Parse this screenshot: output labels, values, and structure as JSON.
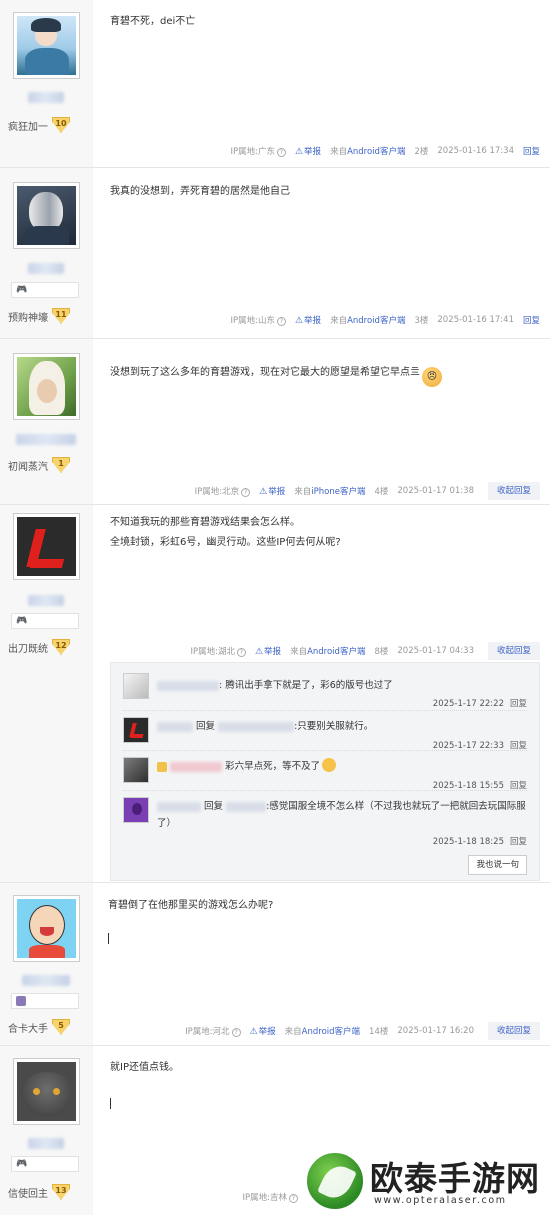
{
  "posts": [
    {
      "text": [
        "育碧不死，dei不亡"
      ],
      "level_name": "疯狂加一",
      "level_num": "10",
      "ip": "IP属地:广东",
      "report": "举报",
      "client_prefix": "来自",
      "client": "Android客户端",
      "floor": "2楼",
      "time": "2025-01-16 17:34",
      "reply": "回复"
    },
    {
      "text": [
        "我真的没想到，弄死育碧的居然是他自己"
      ],
      "level_name": "预购神壕",
      "level_num": "11",
      "ip": "IP属地:山东",
      "report": "举报",
      "client_prefix": "来自",
      "client": "Android客户端",
      "floor": "3楼",
      "time": "2025-01-16 17:41",
      "reply": "回复"
    },
    {
      "text": [
        "没想到玩了这么多年的育碧游戏，现在对它最大的愿望是希望它早点亖"
      ],
      "level_name": "初闻蒸汽",
      "level_num": "1",
      "ip": "IP属地:北京",
      "report": "举报",
      "client_prefix": "来自",
      "client": "iPhone客户端",
      "floor": "4楼",
      "time": "2025-01-17 01:38",
      "reply": "收起回复"
    },
    {
      "text": [
        "不知道我玩的那些育碧游戏结果会怎么样。",
        "全境封锁，彩虹6号，幽灵行动。这些IP何去何从呢?"
      ],
      "level_name": "出刀既统",
      "level_num": "12",
      "ip": "IP属地:湖北",
      "report": "举报",
      "client_prefix": "来自",
      "client": "Android客户端",
      "floor": "8楼",
      "time": "2025-01-17 04:33",
      "reply": "收起回复"
    },
    {
      "text": [
        "育碧倒了在他那里买的游戏怎么办呢?"
      ],
      "level_name": "合卡大手",
      "level_num": "5",
      "ip": "IP属地:河北",
      "report": "举报",
      "client_prefix": "来自",
      "client": "Android客户端",
      "floor": "14楼",
      "time": "2025-01-17 16:20",
      "reply": "收起回复"
    },
    {
      "text": [
        "就IP还值点钱。"
      ],
      "level_name": "信使回主",
      "level_num": "13",
      "ip": "IP属地:吉林"
    }
  ],
  "comments": [
    {
      "text": ": 腾讯出手拿下就是了，彩6的版号也过了",
      "time": "2025-1-17 22:22",
      "reply": "回复"
    },
    {
      "reply_word": "回复",
      "text": ":只要别关服就行。",
      "time": "2025-1-17 22:33",
      "reply": "回复"
    },
    {
      "text": "彩六早点死，等不及了",
      "time": "2025-1-18 15:55",
      "reply": "回复"
    },
    {
      "reply_word": "回复",
      "text": ":感觉国服全境不怎么样（不过我也就玩了一把就回去玩国际服了）",
      "time": "2025-1-18 18:25",
      "reply": "回复"
    }
  ],
  "say_button": "我也说一句",
  "watermark": {
    "name": "欧泰手游网",
    "url": "www.opteralaser.com"
  }
}
